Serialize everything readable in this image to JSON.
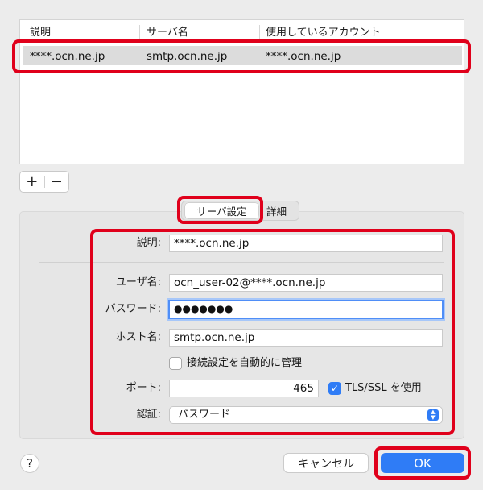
{
  "table": {
    "columns": [
      "説明",
      "サーバ名",
      "使用しているアカウント"
    ],
    "rows": [
      [
        "****.ocn.ne.jp",
        "smtp.ocn.ne.jp",
        "****.ocn.ne.jp"
      ]
    ]
  },
  "list_controls": {
    "add": "+",
    "remove": "−"
  },
  "tabs": {
    "server_settings": "サーバ設定",
    "details": "詳細"
  },
  "form": {
    "description_label": "説明:",
    "description_value": "****.ocn.ne.jp",
    "username_label": "ユーザ名:",
    "username_value": "ocn_user-02@****.ocn.ne.jp",
    "password_label": "パスワード:",
    "password_value": "●●●●●●●",
    "host_label": "ホスト名:",
    "host_value": "smtp.ocn.ne.jp",
    "auto_manage_label": "接続設定を自動的に管理",
    "auto_manage_checked": false,
    "port_label": "ポート:",
    "port_value": "465",
    "tls_label": "TLS/SSL を使用",
    "tls_checked": true,
    "auth_label": "認証:",
    "auth_value": "パスワード"
  },
  "buttons": {
    "help": "?",
    "cancel": "キャンセル",
    "ok": "OK"
  },
  "colors": {
    "accent": "#2f7cf6",
    "highlight": "#e0001b",
    "selection": "#dcdcdc"
  }
}
